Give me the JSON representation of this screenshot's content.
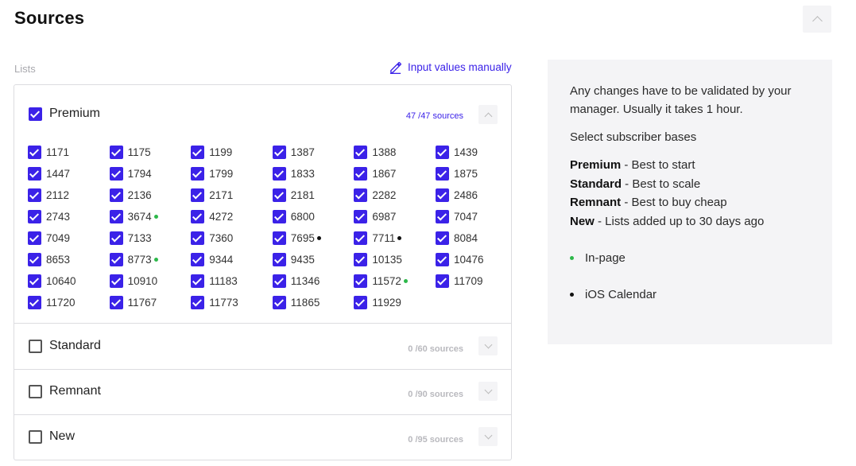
{
  "header": {
    "title": "Sources"
  },
  "lists": {
    "label": "Lists",
    "manual_link": "Input values manually",
    "premium": {
      "name": "Premium",
      "count": "47 /47  sources",
      "items": [
        {
          "v": "1171"
        },
        {
          "v": "1175"
        },
        {
          "v": "1199"
        },
        {
          "v": "1387"
        },
        {
          "v": "1388"
        },
        {
          "v": "1439"
        },
        {
          "v": "1447"
        },
        {
          "v": "1794"
        },
        {
          "v": "1799"
        },
        {
          "v": "1833"
        },
        {
          "v": "1867"
        },
        {
          "v": "1875"
        },
        {
          "v": "2112"
        },
        {
          "v": "2136"
        },
        {
          "v": "2171"
        },
        {
          "v": "2181"
        },
        {
          "v": "2282"
        },
        {
          "v": "2486"
        },
        {
          "v": "2743"
        },
        {
          "v": "3674",
          "dot": "green"
        },
        {
          "v": "4272"
        },
        {
          "v": "6800"
        },
        {
          "v": "6987"
        },
        {
          "v": "7047"
        },
        {
          "v": "7049"
        },
        {
          "v": "7133"
        },
        {
          "v": "7360"
        },
        {
          "v": "7695",
          "dot": "black"
        },
        {
          "v": "7711",
          "dot": "black"
        },
        {
          "v": "8084"
        },
        {
          "v": "8653"
        },
        {
          "v": "8773",
          "dot": "green"
        },
        {
          "v": "9344"
        },
        {
          "v": "9435"
        },
        {
          "v": "10135"
        },
        {
          "v": "10476"
        },
        {
          "v": "10640"
        },
        {
          "v": "10910"
        },
        {
          "v": "11183"
        },
        {
          "v": "11346"
        },
        {
          "v": "11572",
          "dot": "green"
        },
        {
          "v": "11709"
        },
        {
          "v": "11720"
        },
        {
          "v": "11767"
        },
        {
          "v": "11773"
        },
        {
          "v": "11865"
        },
        {
          "v": "11929"
        }
      ]
    },
    "standard": {
      "name": "Standard",
      "count": "0 /60 sources"
    },
    "remnant": {
      "name": "Remnant",
      "count": "0 /90 sources"
    },
    "new": {
      "name": "New",
      "count": "0 /95 sources"
    }
  },
  "info": {
    "notice": "Any changes have to be validated by your manager. Usually it takes 1 hour.",
    "select_label": "Select subscriber bases",
    "tiers": [
      {
        "name": "Premium",
        "desc": " - Best to start"
      },
      {
        "name": "Standard",
        "desc": " - Best to scale"
      },
      {
        "name": "Remnant",
        "desc": " - Best to buy cheap"
      },
      {
        "name": "New",
        "desc": " - Lists added up to 30 days ago"
      }
    ],
    "legend": [
      {
        "label": "In-page",
        "color": "#2db84a"
      },
      {
        "label": "iOS Calendar",
        "color": "#111111"
      }
    ]
  },
  "colors": {
    "accent": "#3b22e8",
    "green_dot": "#2db84a",
    "black_dot": "#111111"
  },
  "icons": {
    "collapse": "chevron-up-icon",
    "expand": "chevron-down-icon",
    "edit": "pencil-icon"
  }
}
